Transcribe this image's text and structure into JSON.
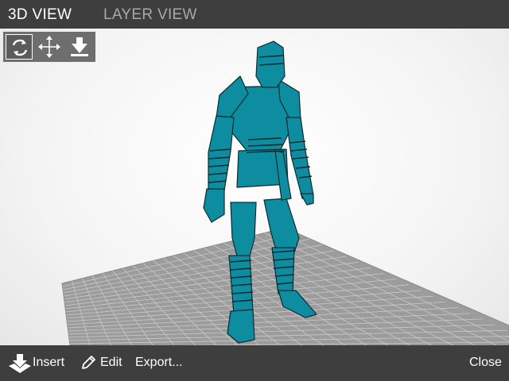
{
  "tabs": {
    "view3d": "3D VIEW",
    "layer": "LAYER VIEW"
  },
  "tools": [
    {
      "icon": "rotate-icon",
      "active": true
    },
    {
      "icon": "move-icon",
      "active": false
    },
    {
      "icon": "lay-flat-icon",
      "active": false
    }
  ],
  "bottom": {
    "insert_label": "Insert",
    "edit_label": "Edit",
    "export_label": "Export...",
    "close_label": "Close"
  },
  "colors": {
    "bar": "#3e3e3e",
    "model": "#0f8da0",
    "model_outline": "#0a2a30",
    "platform": "#999999",
    "grid": "#c8c8c8"
  }
}
